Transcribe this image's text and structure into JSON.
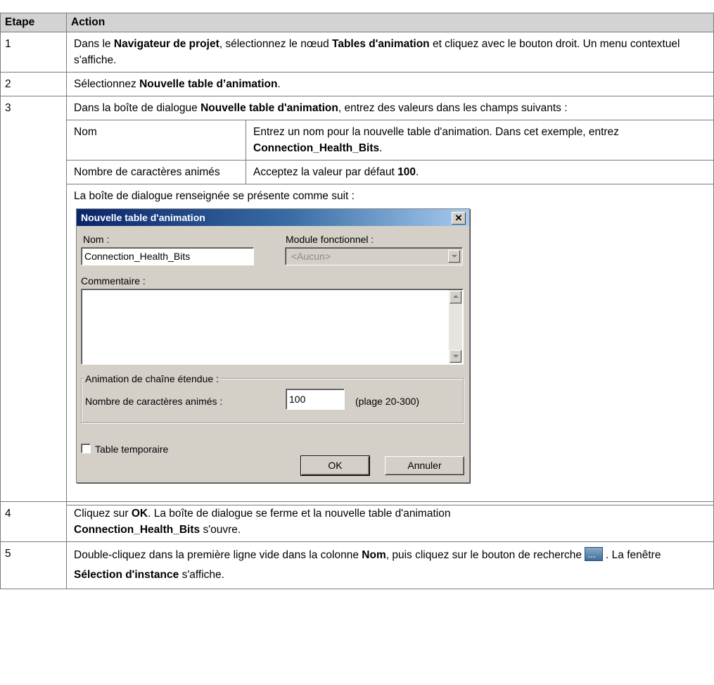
{
  "table": {
    "header": {
      "step": "Etape",
      "action": "Action"
    },
    "rows": {
      "r1": {
        "step": "1",
        "t1": "Dans le ",
        "b1": "Navigateur de projet",
        "t2": ", sélectionnez le nœud ",
        "b2": "Tables d'animation",
        "t3": " et cliquez avec le bouton droit. Un menu contextuel s'affiche."
      },
      "r2": {
        "step": "2",
        "t1": "Sélectionnez ",
        "b1": "Nouvelle table d’animation",
        "t2": "."
      },
      "r3": {
        "step": "3",
        "t1": "Dans la boîte de dialogue ",
        "b1": "Nouvelle table d'animation",
        "t2": ", entrez des valeurs dans les champs suivants :",
        "nom_label": "Nom",
        "nom_t1": "Entrez un nom pour la nouvelle table d'animation. Dans cet exemple, entrez ",
        "nom_b1": "Connection_Health_Bits",
        "nom_t2": ".",
        "nb_label": "Nombre de caractères animés",
        "nb_t1": "Acceptez la valeur par défaut ",
        "nb_b1": "100",
        "nb_t2": ".",
        "dialog_intro": "La boîte de dialogue renseignée se présente comme suit :"
      },
      "r4": {
        "step": "4",
        "t1": "Cliquez sur ",
        "b1": "OK",
        "t2": ". La boîte de dialogue se ferme et la nouvelle table d'animation ",
        "b2": "Connection_Health_Bits",
        "t3": " s'ouvre."
      },
      "r5": {
        "step": "5",
        "t1": "Double-cliquez dans la première ligne vide dans la colonne ",
        "b1": "Nom",
        "t2": ", puis cliquez sur le bouton de recherche",
        "t3": ". La fenêtre ",
        "b2": "Sélection d'instance",
        "t4": " s'affiche."
      }
    }
  },
  "dialog": {
    "title": "Nouvelle table d'animation",
    "close_glyph": "✕",
    "nom_label": "Nom :",
    "nom_value": "Connection_Health_Bits",
    "module_label": "Module fonctionnel :",
    "module_value": "<Aucun>",
    "comment_label": "Commentaire :",
    "comment_value": "",
    "group_label": "Animation de chaîne étendue :",
    "chars_label": "Nombre de caractères animés :",
    "chars_value": "100",
    "range_text": "(plage 20-300)",
    "temp_label": "Table temporaire",
    "ok": "OK",
    "cancel": "Annuler"
  },
  "icons": {
    "browse": "browse-ellipsis-icon",
    "close": "close-icon"
  }
}
